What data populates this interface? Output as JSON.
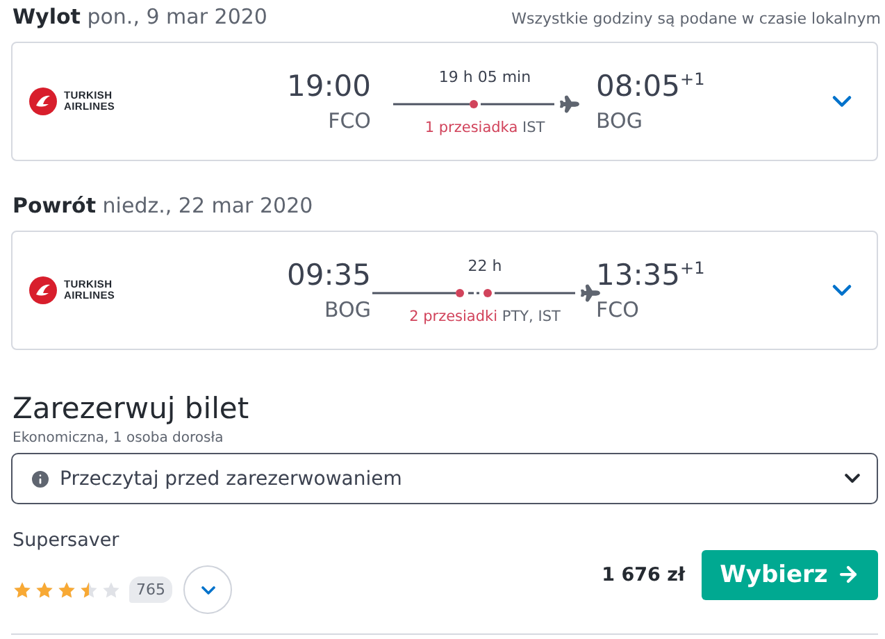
{
  "legs": [
    {
      "label": "Wylot",
      "date": "pon., 9 mar 2020",
      "note": "Wszystkie godziny są podane w czasie lokalnym",
      "airline": [
        "TURKISH",
        "AIRLINES"
      ],
      "depart_time": "19:00",
      "depart_airport": "FCO",
      "duration": "19 h 05 min",
      "stops_label": "1 przesiadka",
      "stops": [
        "IST"
      ],
      "arrive_time": "08:05",
      "day_offset": "+1",
      "arrive_airport": "BOG"
    },
    {
      "label": "Powrót",
      "date": "niedz., 22 mar 2020",
      "airline": [
        "TURKISH",
        "AIRLINES"
      ],
      "depart_time": "09:35",
      "depart_airport": "BOG",
      "duration": "22 h",
      "stops_label": "2 przesiadki",
      "stops": [
        "PTY",
        "IST"
      ],
      "arrive_time": "13:35",
      "day_offset": "+1",
      "arrive_airport": "FCO"
    }
  ],
  "stop_separator": ",",
  "booking": {
    "title": "Zarezerwuj bilet",
    "subtitle": "Ekonomiczna, 1 osoba dorosła",
    "info": "Przeczytaj przed zarezerwowaniem",
    "fare": "Supersaver",
    "stars": 3.5,
    "reviews": "765",
    "price": "1 676 zł",
    "button": "Wybierz"
  }
}
